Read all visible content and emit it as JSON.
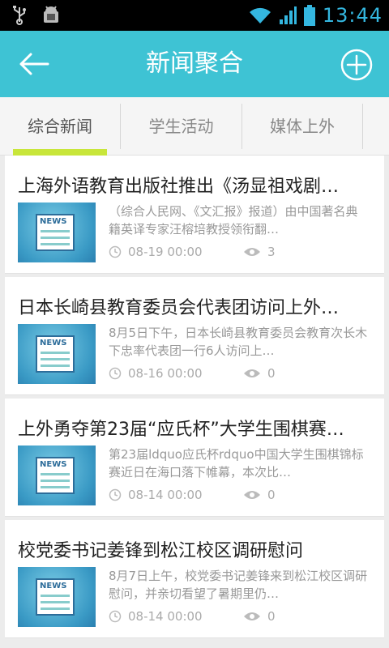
{
  "status_bar": {
    "time": "13:44",
    "icons": [
      "usb-icon",
      "android-debug-icon",
      "wifi-icon",
      "signal-icon",
      "battery-icon"
    ]
  },
  "header": {
    "title": "新闻聚合",
    "back_icon": "back-arrow-icon",
    "add_icon": "add-circle-icon",
    "bg_color": "#3ec3d4"
  },
  "tabs": [
    {
      "label": "综合新闻",
      "active": true
    },
    {
      "label": "学生活动",
      "active": false
    },
    {
      "label": "媒体上外",
      "active": false
    }
  ],
  "accent_color": "#c8e63a",
  "news": [
    {
      "title": "上海外语教育出版社推出《汤显祖戏剧…",
      "summary": "（综合人民网、《文汇报》报道）由中国著名典籍英译专家汪榕培教授领衔翻…",
      "time": "08-19 00:00",
      "views": "3",
      "thumb_label": "NEWS"
    },
    {
      "title": "日本长崎县教育委员会代表团访问上外…",
      "summary": "8月5日下午，日本长崎县教育委员会教育次长木下忠率代表团一行6人访问上…",
      "time": "08-16 00:00",
      "views": "0",
      "thumb_label": "NEWS"
    },
    {
      "title": "上外勇夺第23届“应氏杯”大学生围棋赛…",
      "summary": "第23届ldquo应氏杯rdquo中国大学生围棋锦标赛近日在海口落下帷幕，本次比…",
      "time": "08-14 00:00",
      "views": "0",
      "thumb_label": "NEWS"
    },
    {
      "title": "校党委书记姜锋到松江校区调研慰问",
      "summary": "8月7日上午，校党委书记姜锋来到松江校区调研慰问，并亲切看望了暑期里仍…",
      "time": "08-14 00:00",
      "views": "0",
      "thumb_label": "NEWS"
    }
  ]
}
